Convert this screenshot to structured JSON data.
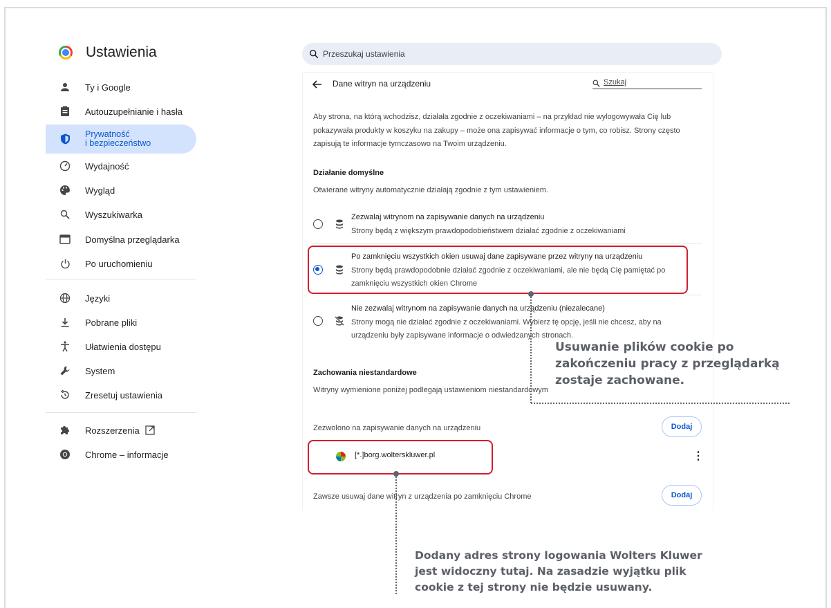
{
  "header": {
    "app_title": "Ustawienia",
    "search_placeholder": "Przeszukaj ustawienia"
  },
  "sidebar": {
    "items": [
      {
        "label": "Ty i Google",
        "icon": "person-icon"
      },
      {
        "label": "Autouzupełnianie i hasła",
        "icon": "clipboard-icon"
      },
      {
        "label_line1": "Prywatność",
        "label_line2": "i bezpieczeństwo",
        "icon": "shield-icon",
        "active": true
      },
      {
        "label": "Wydajność",
        "icon": "speedometer-icon"
      },
      {
        "label": "Wygląd",
        "icon": "palette-icon"
      },
      {
        "label": "Wyszukiwarka",
        "icon": "search-icon"
      },
      {
        "label": "Domyślna przeglądarka",
        "icon": "browser-icon"
      },
      {
        "label": "Po uruchomieniu",
        "icon": "power-icon"
      },
      {
        "label": "Języki",
        "icon": "globe-icon"
      },
      {
        "label": "Pobrane pliki",
        "icon": "download-icon"
      },
      {
        "label": "Ułatwienia dostępu",
        "icon": "accessibility-icon"
      },
      {
        "label": "System",
        "icon": "wrench-icon"
      },
      {
        "label": "Zresetuj ustawienia",
        "icon": "reset-icon"
      },
      {
        "label": "Rozszerzenia",
        "icon": "puzzle-icon"
      },
      {
        "label": "Chrome – informacje",
        "icon": "chrome-icon"
      }
    ]
  },
  "page": {
    "title": "Dane witryn na urządzeniu",
    "search_label": "Szukaj",
    "intro": [
      "Aby strona, na którą wchodzisz, działała zgodnie z oczekiwaniami – na przykład nie wylogowywała Cię lub",
      "pokazywała produkty w koszyku na zakupy – może ona zapisywać informacje o tym, co robisz. Strony często",
      "zapisują te informacje tymczasowo na Twoim urządzeniu."
    ],
    "default_heading": "Działanie domyślne",
    "default_desc": "Otwierane witryny automatycznie działają zgodnie z tym ustawieniem.",
    "options": [
      {
        "line1": "Zezwalaj witrynom na zapisywanie danych na urządzeniu",
        "line2": "Strony będą z większym prawdopodobieństwem działać zgodnie z oczekiwaniami",
        "selected": false
      },
      {
        "line1": "Po zamknięciu wszystkich okien usuwaj dane zapisywane przez witryny na urządzeniu",
        "line2": "Strony będą prawdopodobnie działać zgodnie z oczekiwaniami, ale nie będą Cię pamiętać po",
        "line3": "zamknięciu wszystkich okien Chrome",
        "selected": true
      },
      {
        "line1": "Nie zezwalaj witrynom na zapisywanie danych na urządzeniu (niezalecane)",
        "line2": "Strony mogą nie działać zgodnie z oczekiwaniami. Wybierz tę opcję, jeśli nie chcesz, aby na",
        "line3": "urządzeniu były zapisywane informacje o odwiedzanych stronach.",
        "selected": false
      }
    ],
    "custom_heading": "Zachowania niestandardowe",
    "custom_desc": "Witryny wymienione poniżej podlegają ustawieniom niestandardowym",
    "allowed_label": "Zezwolono na zapisywanie danych na urządzeniu",
    "add_label": "Dodaj",
    "site_entry": "[*.]borg.wolterskluwer.pl",
    "more_label": "⋮",
    "always_clear_label": "Zawsze usuwaj dane witryn z urządzenia po zamknięciu Chrome"
  },
  "annotations": {
    "note1": [
      "Usuwanie plików cookie po",
      "zakończeniu pracy z przeglądarką",
      "zostaje zachowane."
    ],
    "note2": [
      "Dodany adres strony logowania Wolters Kluwer",
      "jest widoczny tutaj. Na zasadzie wyjątku plik",
      "cookie z tej strony nie będzie usuwany."
    ]
  },
  "colors": {
    "accent": "#0b57d0",
    "active_bg": "#d3e3fd",
    "highlight": "#d21d2f",
    "annotation": "#5b5f66"
  }
}
